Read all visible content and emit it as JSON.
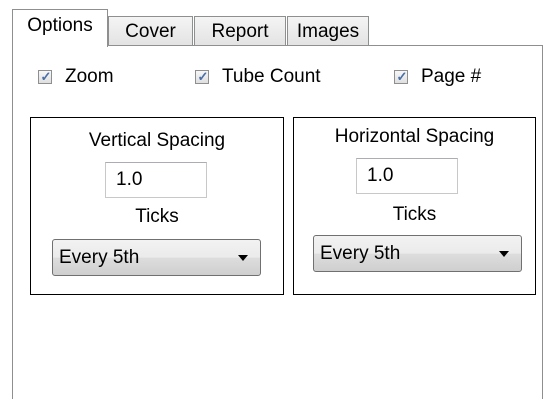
{
  "tabs": [
    {
      "label": "Options",
      "active": true
    },
    {
      "label": "Cover",
      "active": false
    },
    {
      "label": "Report",
      "active": false
    },
    {
      "label": "Images",
      "active": false
    }
  ],
  "options": {
    "zoom": {
      "label": "Zoom",
      "checked": true
    },
    "tube_count": {
      "label": "Tube Count",
      "checked": true
    },
    "page_number": {
      "label": "Page #",
      "checked": true
    }
  },
  "vertical": {
    "title": "Vertical Spacing",
    "spacing_value": "1.0",
    "ticks_label": "Ticks",
    "ticks_selected": "Every 5th"
  },
  "horizontal": {
    "title": "Horizontal Spacing",
    "spacing_value": "1.0",
    "ticks_label": "Ticks",
    "ticks_selected": "Every 5th"
  },
  "icons": {
    "checkmark": "✓",
    "dropdown": "chevron-down-icon"
  }
}
